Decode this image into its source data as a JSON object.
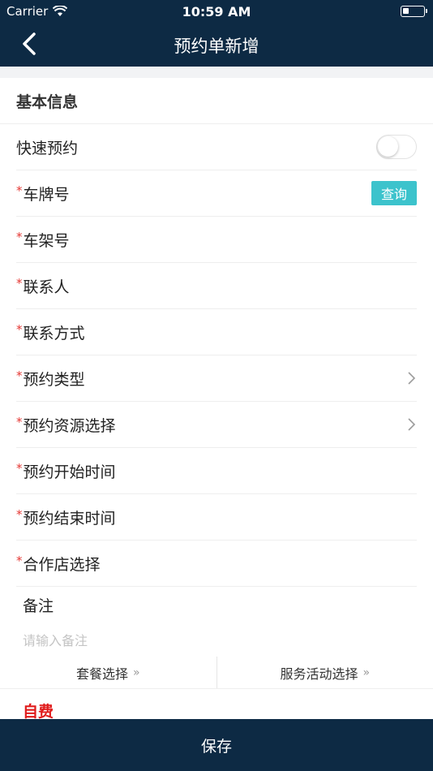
{
  "status_bar": {
    "carrier": "Carrier",
    "time": "10:59 AM"
  },
  "nav": {
    "title": "预约单新增"
  },
  "section": {
    "title": "基本信息"
  },
  "fields": {
    "quick_booking": {
      "label": "快速预约",
      "enabled": false
    },
    "plate_number": {
      "required_mark": "*",
      "label": "车牌号",
      "button": "查询"
    },
    "vin": {
      "required_mark": "*",
      "label": "车架号"
    },
    "contact": {
      "required_mark": "*",
      "label": "联系人"
    },
    "contact_method": {
      "required_mark": "*",
      "label": "联系方式"
    },
    "booking_type": {
      "required_mark": "*",
      "label": "预约类型"
    },
    "booking_resource": {
      "required_mark": "*",
      "label": "预约资源选择"
    },
    "start_time": {
      "required_mark": "*",
      "label": "预约开始时间"
    },
    "end_time": {
      "required_mark": "*",
      "label": "预约结束时间"
    },
    "partner_store": {
      "required_mark": "*",
      "label": "合作店选择"
    }
  },
  "note": {
    "label": "备注",
    "placeholder": "请输入备注",
    "value": ""
  },
  "options": {
    "package_label": "套餐选择",
    "activity_label": "服务活动选择",
    "more_glyph": "»"
  },
  "payment": {
    "label": "自费"
  },
  "footer": {
    "save_label": "保存"
  },
  "colors": {
    "nav_bg": "#0d2a44",
    "accent_button": "#3cc3cc",
    "required_mark": "#e53935",
    "self_pay": "#e01b1b"
  },
  "icons": [
    "wifi-icon",
    "battery-icon",
    "back-arrow-icon",
    "chevron-right-icon"
  ]
}
